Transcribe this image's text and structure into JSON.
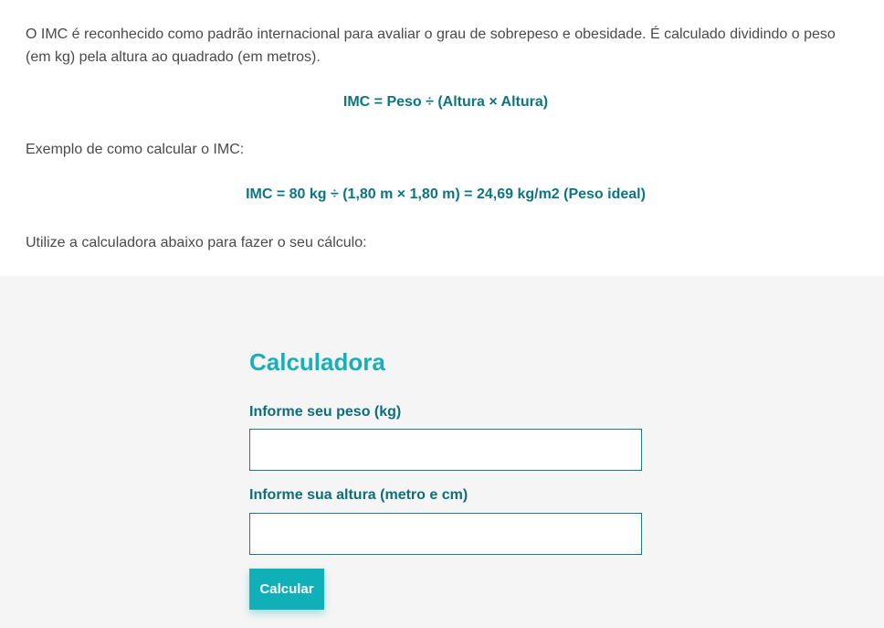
{
  "intro": {
    "paragraph1": "O IMC é reconhecido como padrão internacional para avaliar o grau de sobrepeso e obesidade. É calculado dividindo o peso (em kg) pela altura ao quadrado (em metros).",
    "formula": "IMC = Peso ÷ (Altura × Altura)",
    "example_label": "Exemplo de como calcular o IMC:",
    "example_formula": "IMC = 80 kg ÷ (1,80 m × 1,80 m) = 24,69 kg/m2 (Peso ideal)",
    "instruction": "Utilize a calculadora abaixo para fazer o seu cálculo:"
  },
  "calculator": {
    "title": "Calculadora",
    "weight_label": "Informe seu peso (kg)",
    "weight_value": "",
    "height_label": "Informe sua altura (metro e cm)",
    "height_value": "",
    "submit_label": "Calcular"
  },
  "colors": {
    "formula_text": "#0c7580",
    "title": "#19afb8",
    "label": "#0c6f7a",
    "button": "#0fb0b8",
    "section_background": "#f5f5f5"
  }
}
